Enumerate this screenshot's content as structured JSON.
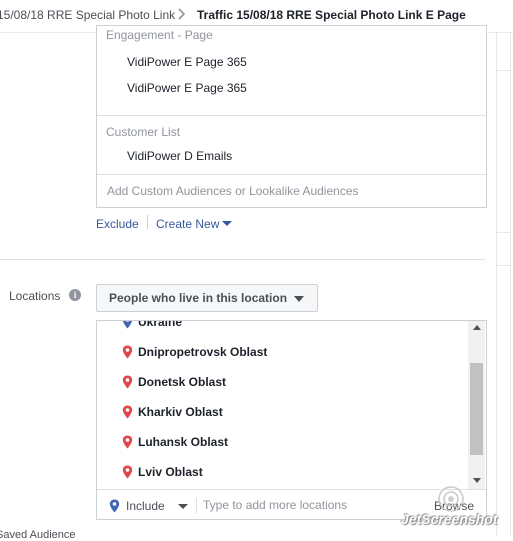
{
  "breadcrumb": {
    "previous": "15/08/18 RRE Special Photo Link",
    "current": "Traffic 15/08/18 RRE Special Photo Link E Page"
  },
  "custom_audiences": {
    "engagement_label": "Engagement - Page",
    "engagement_items": [
      "VidiPower E Page 365",
      "VidiPower E Page 365"
    ],
    "customer_list_label": "Customer List",
    "customer_list_items": [
      "VidiPower D Emails"
    ],
    "add_placeholder": "Add Custom Audiences or Lookalike Audiences",
    "exclude_link": "Exclude",
    "create_new_link": "Create New"
  },
  "locations": {
    "label": "Locations",
    "info_icon_glyph": "i",
    "type_dropdown": "People who live in this location",
    "items": [
      {
        "name": "Ukraine",
        "pin": "blue"
      },
      {
        "name": "Dnipropetrovsk Oblast",
        "pin": "red"
      },
      {
        "name": "Donetsk Oblast",
        "pin": "red"
      },
      {
        "name": "Kharkiv Oblast",
        "pin": "red"
      },
      {
        "name": "Luhansk Oblast",
        "pin": "red"
      },
      {
        "name": "Lviv Oblast",
        "pin": "red"
      }
    ],
    "include_label": "Include",
    "input_placeholder": "Type to add more locations",
    "browse_label": "Browse"
  },
  "bottom_partial_text": "Saved Audience",
  "watermark": "JetScreenshot",
  "colors": {
    "link": "#365899",
    "pin_include": "#4267b2",
    "pin_exclude": "#e0464a",
    "border": "#ccd0d5"
  }
}
